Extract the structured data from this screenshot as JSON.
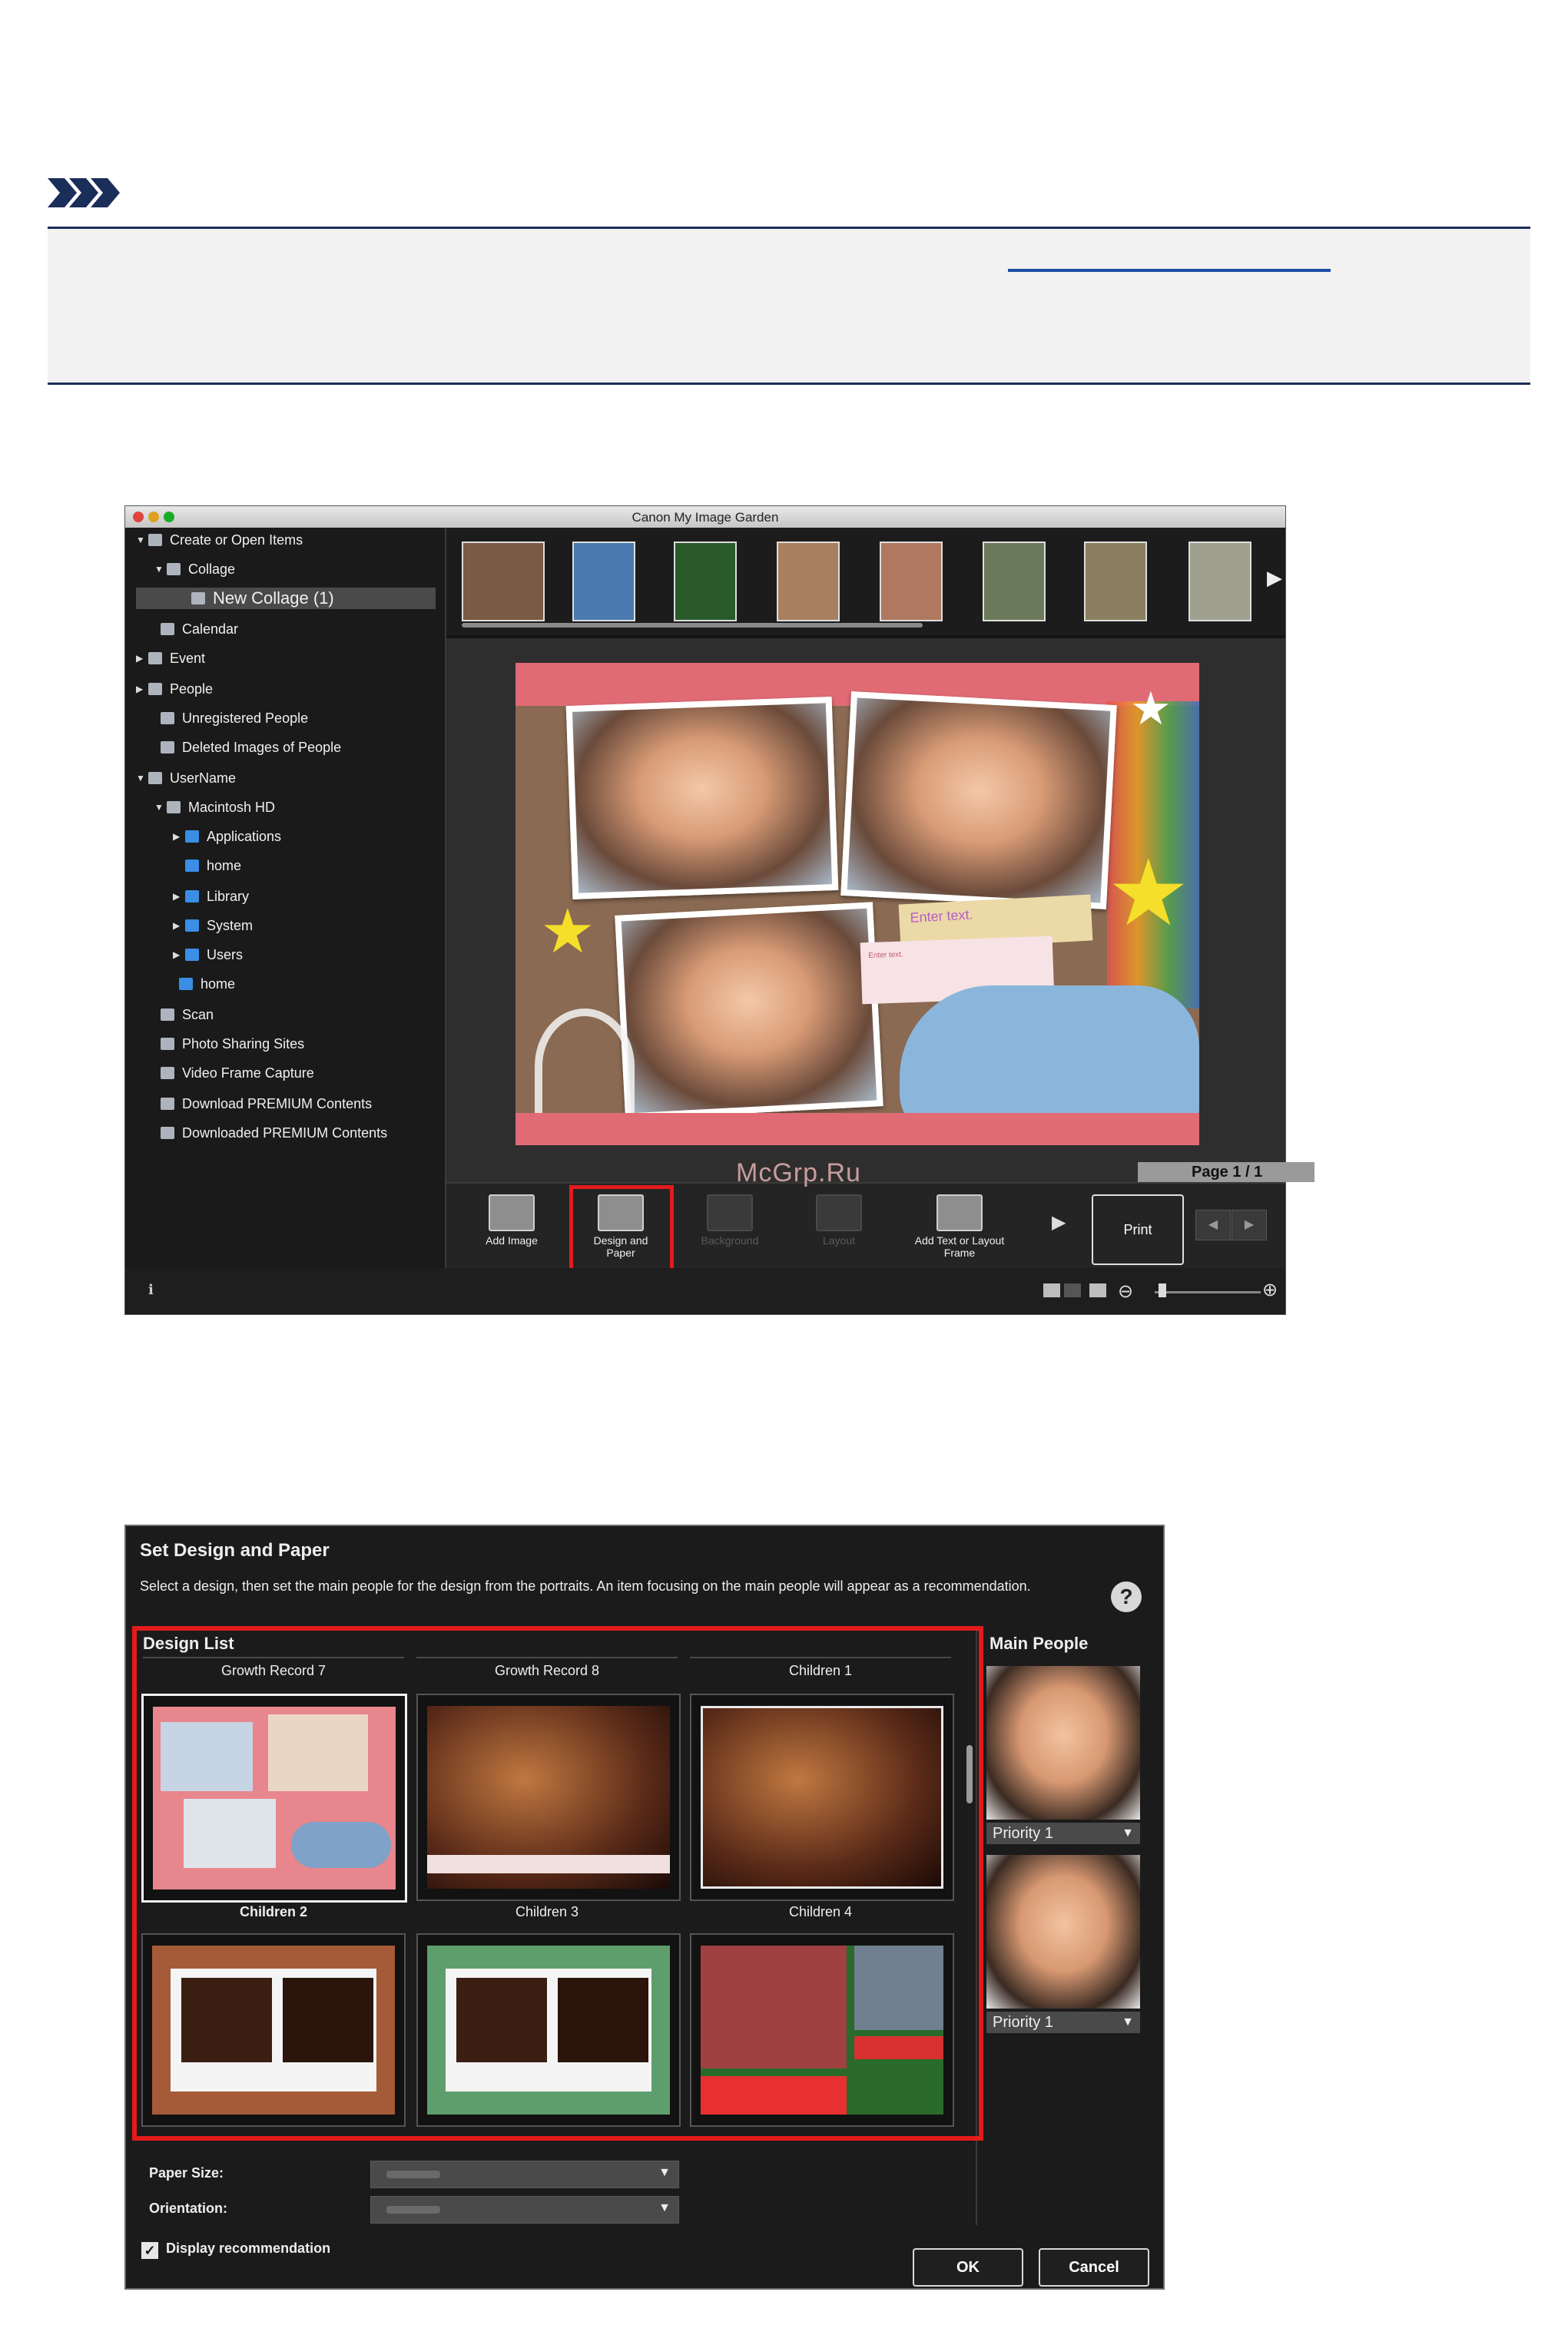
{
  "window": {
    "title": "Canon My Image Garden",
    "traffic_lights": [
      "#e0443e",
      "#dea123",
      "#1aab29"
    ]
  },
  "sidebar": {
    "items": [
      {
        "label": "Create or Open Items",
        "icon": "create-items-icon",
        "expanded": true
      },
      {
        "label": "Collage",
        "icon": "collage-icon",
        "expanded": true
      },
      {
        "label": "New Collage (1)",
        "icon": "new-collage-icon",
        "selected": true
      },
      {
        "label": "Calendar",
        "icon": "calendar-icon"
      },
      {
        "label": "Event",
        "icon": "event-icon",
        "expandable": true
      },
      {
        "label": "People",
        "icon": "people-icon",
        "expandable": true
      },
      {
        "label": "Unregistered People",
        "icon": "unregistered-people-icon"
      },
      {
        "label": "Deleted Images of People",
        "icon": "deleted-people-icon"
      },
      {
        "label": "UserName",
        "icon": "computer-icon",
        "expanded": true
      },
      {
        "label": "Macintosh HD",
        "icon": "hard-drive-icon",
        "expanded": true
      },
      {
        "label": "Applications",
        "icon": "folder-icon",
        "expandable": true
      },
      {
        "label": "home",
        "icon": "folder-icon"
      },
      {
        "label": "Library",
        "icon": "folder-icon",
        "expandable": true
      },
      {
        "label": "System",
        "icon": "folder-icon",
        "expandable": true
      },
      {
        "label": "Users",
        "icon": "folder-icon",
        "expandable": true
      },
      {
        "label": "home",
        "icon": "home-folder-icon"
      },
      {
        "label": "Scan",
        "icon": "scan-icon"
      },
      {
        "label": "Photo Sharing Sites",
        "icon": "photo-sharing-icon"
      },
      {
        "label": "Video Frame Capture",
        "icon": "video-frame-icon"
      },
      {
        "label": "Download PREMIUM Contents",
        "icon": "download-icon"
      },
      {
        "label": "Downloaded PREMIUM Contents",
        "icon": "downloaded-icon"
      }
    ]
  },
  "canvas": {
    "enter_text": "Enter text.",
    "enter_text_small": "Enter text.",
    "page_indicator": "Page 1 / 1"
  },
  "watermark": "McGrp.Ru",
  "toolbar": {
    "add_image": "Add Image",
    "design_and_paper": "Design and Paper",
    "background": "Background",
    "layout": "Layout",
    "add_text": "Add Text or Layout Frame",
    "print": "Print"
  },
  "dialog": {
    "title": "Set Design and Paper",
    "description": "Select a design, then set the main people for the design from the portraits. An item focusing on the main people will appear as a recommendation.",
    "design_list_label": "Design List",
    "main_people_label": "Main People",
    "designs_row1": [
      "Growth Record 7",
      "Growth Record 8",
      "Children 1"
    ],
    "designs_row2": [
      "Children 2",
      "Children 3",
      "Children 4"
    ],
    "people": [
      {
        "priority": "Priority 1"
      },
      {
        "priority": "Priority 1"
      }
    ],
    "paper_size_label": "Paper Size:",
    "orientation_label": "Orientation:",
    "display_recommendation": "Display recommendation",
    "display_recommendation_checked": true,
    "ok": "OK",
    "cancel": "Cancel"
  },
  "colors": {
    "highlight": "#e21b1b",
    "note_rule": "#1b2d59",
    "link": "#1b4fa6"
  }
}
